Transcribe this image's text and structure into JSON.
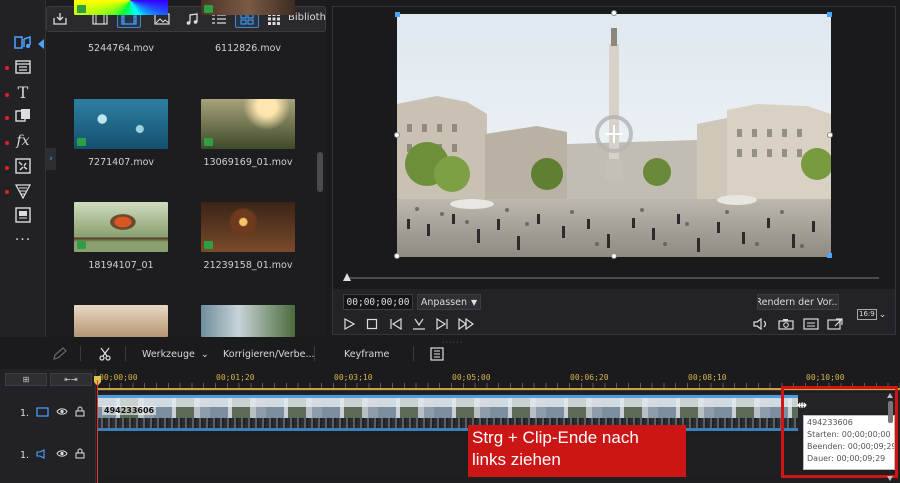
{
  "library": {
    "toolbar_label": "Biblioth",
    "clips": [
      {
        "name": "5244764.mov"
      },
      {
        "name": "6112826.mov"
      },
      {
        "name": "7271407.mov"
      },
      {
        "name": "13069169_01.mov"
      },
      {
        "name": "18194107_01"
      },
      {
        "name": "21239158_01.mov"
      },
      {
        "name": ""
      },
      {
        "name": ""
      }
    ]
  },
  "preview": {
    "timecode": "00;00;00;00",
    "fit_label": "Anpassen",
    "render_label": "Rendern der Vor...",
    "aspect_label": "16:9"
  },
  "toolbar": {
    "tools_label": "Werkzeuge",
    "fix_label": "Korrigieren/Verbe...",
    "keyframe_label": "Keyframe"
  },
  "timeline": {
    "ruler": [
      "00;00;00",
      "00;01;20",
      "00;03;10",
      "00;05;00",
      "00;06;20",
      "00;08;10",
      "00;10;00"
    ],
    "tracks": [
      {
        "label": "1."
      },
      {
        "label": "1."
      }
    ],
    "clip_title": "494233606"
  },
  "tooltip": {
    "id": "494233606",
    "start": "Starten: 00;00;00;00",
    "end": "Beenden: 00;00;09;29",
    "duration": "Dauer: 00;00;09;29"
  },
  "callout": {
    "line1": "Strg + Clip-Ende nach",
    "line2": "links ziehen"
  },
  "colors": {
    "accent": "#4aa3ff",
    "playhead": "#e23a3a",
    "ruler": "#c9a43b",
    "callout": "#cc1616",
    "clip_badge": "#2ea043"
  }
}
